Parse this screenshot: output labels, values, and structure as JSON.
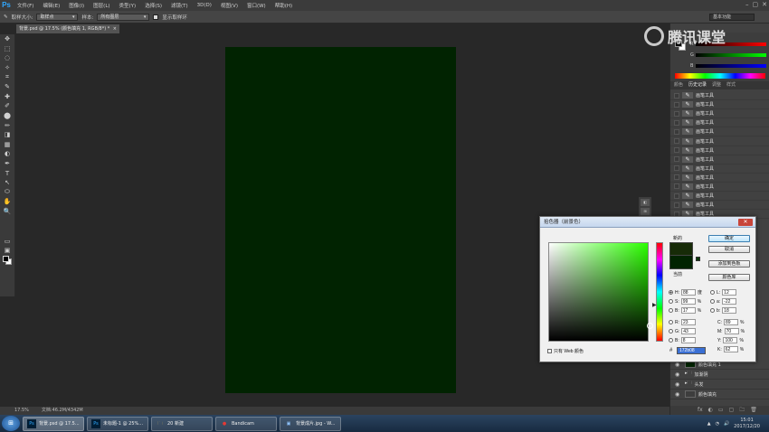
{
  "menubar": {
    "logo": "Ps",
    "items": [
      "文件(F)",
      "编辑(E)",
      "图像(I)",
      "图层(L)",
      "类型(Y)",
      "选择(S)",
      "滤镜(T)",
      "3D(D)",
      "视图(V)",
      "窗口(W)",
      "帮助(H)"
    ],
    "window_controls": [
      "–",
      "▢",
      "✕"
    ]
  },
  "options_bar": {
    "tool_glyph": "✎",
    "sample_size_label": "取样大小:",
    "sample_size_value": "取样点",
    "sample_label": "样本:",
    "sample_value": "所有图层",
    "show_ring_label": "显示取样环",
    "workspace": "基本功能"
  },
  "toolbox": {
    "tools": [
      "✥",
      "⬚",
      "◌",
      "✧",
      "⌗",
      "✎",
      "✚",
      "✐",
      "⬤",
      "✏",
      "◨",
      "▦",
      "◐",
      "✒",
      "T",
      "↖",
      "⬭",
      "✋",
      "🔍",
      "▭",
      "▣"
    ]
  },
  "document": {
    "tab_title": "背景.psd @ 17.5% (颜色填充 1, RGB/8*) *",
    "tab_close": "×",
    "canvas_color": "#012301"
  },
  "statusbar": {
    "zoom": "17.5%",
    "doc_info": "文档:46.2M/4342M"
  },
  "watermark": {
    "text": "腾讯课堂"
  },
  "color_panel": {
    "labels": [
      "R",
      "G",
      "B"
    ]
  },
  "panel_tabs": [
    "颜色",
    "历史记录",
    "调整",
    "样式"
  ],
  "history": {
    "item_label": "画笔工具",
    "count": 14
  },
  "mini_strip": [
    "◧",
    "⊞"
  ],
  "layers": [
    {
      "name": "颜色填充 1"
    },
    {
      "name": "加渐阴",
      "folder": true
    },
    {
      "name": "头发",
      "folder": true
    },
    {
      "name": "颜色填充"
    }
  ],
  "layer_bottom_icons": [
    "fx",
    "◐",
    "▭",
    "▢",
    "🗀",
    "🗑"
  ],
  "picker": {
    "title": "拾色器（前景色）",
    "close": "✕",
    "new_label": "新的",
    "current_label": "当前",
    "buttons": [
      "确定",
      "取消",
      "添加到色板",
      "颜色库"
    ],
    "fields": {
      "H": {
        "value": "88",
        "unit": "度"
      },
      "S": {
        "value": "99",
        "unit": "%"
      },
      "B": {
        "value": "17",
        "unit": "%"
      },
      "R": {
        "value": "23",
        "unit": ""
      },
      "G": {
        "value": "43",
        "unit": ""
      },
      "Bc": {
        "label": "B",
        "value": "8",
        "unit": ""
      },
      "L": {
        "value": "12",
        "unit": ""
      },
      "a": {
        "value": "-22",
        "unit": ""
      },
      "b": {
        "value": "18",
        "unit": ""
      },
      "C": {
        "value": "89",
        "unit": "%"
      },
      "M": {
        "value": "70",
        "unit": "%"
      },
      "Y": {
        "value": "100",
        "unit": "%"
      },
      "K": {
        "value": "62",
        "unit": "%"
      }
    },
    "hex_label": "#",
    "hex_value": "172b08",
    "web_only_label": "只有 Web 颜色",
    "new_color": "#172b08",
    "current_color": "#012301"
  },
  "taskbar": {
    "start": "⊞",
    "buttons": [
      {
        "icon": "Ps",
        "label": "背景.psd @ 17.5..."
      },
      {
        "icon": "Ps",
        "label": "未标题-1 @ 25%..."
      },
      {
        "icon": "🗀",
        "label": "20 新建"
      },
      {
        "icon": "●",
        "label": "Bandicam"
      },
      {
        "icon": "▣",
        "label": "背景成片.jpg - W..."
      }
    ],
    "tray_icons": [
      "▲",
      "◔",
      "🔊"
    ],
    "time": "15:01",
    "date": "2017/12/20"
  }
}
